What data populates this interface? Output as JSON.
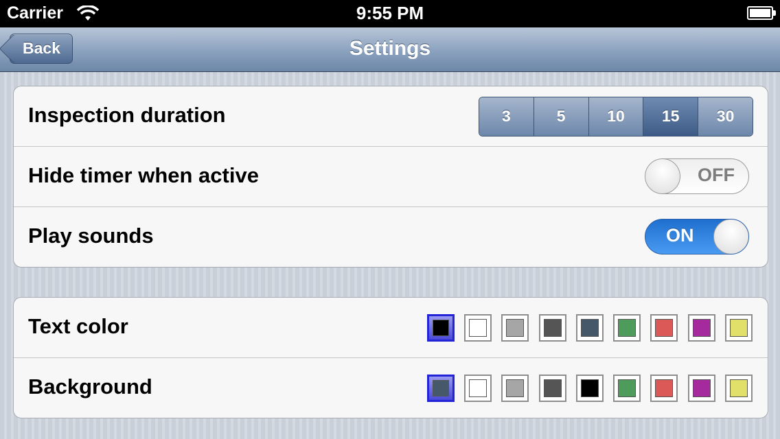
{
  "status_bar": {
    "carrier": "Carrier",
    "time": "9:55 PM"
  },
  "nav": {
    "back_label": "Back",
    "title": "Settings"
  },
  "inspection": {
    "label": "Inspection duration",
    "options": [
      "3",
      "5",
      "10",
      "15",
      "30"
    ],
    "selected": "15"
  },
  "hide_timer": {
    "label": "Hide timer when active",
    "state_text": "OFF"
  },
  "play_sounds": {
    "label": "Play sounds",
    "state_text": "ON"
  },
  "text_color": {
    "label": "Text color",
    "swatches": [
      "#000000",
      "#ffffff",
      "#a6a6a6",
      "#555555",
      "#44586a",
      "#4e9b5b",
      "#db5a58",
      "#a52a9e",
      "#e0e06a"
    ],
    "selected_index": 0
  },
  "background": {
    "label": "Background",
    "swatches": [
      "#45596b",
      "#ffffff",
      "#a6a6a6",
      "#555555",
      "#000000",
      "#4e9b5b",
      "#db5a58",
      "#a52a9e",
      "#e0e06a"
    ],
    "selected_index": 0
  },
  "accent_colors": {
    "switch_on": "#2f80e0",
    "selected_swatch_border": "#2323d8",
    "nav_bar": "#8ea4c0"
  },
  "icons": {
    "wifi": "wifi-icon",
    "battery": "battery-icon",
    "back": "back-chevron"
  }
}
